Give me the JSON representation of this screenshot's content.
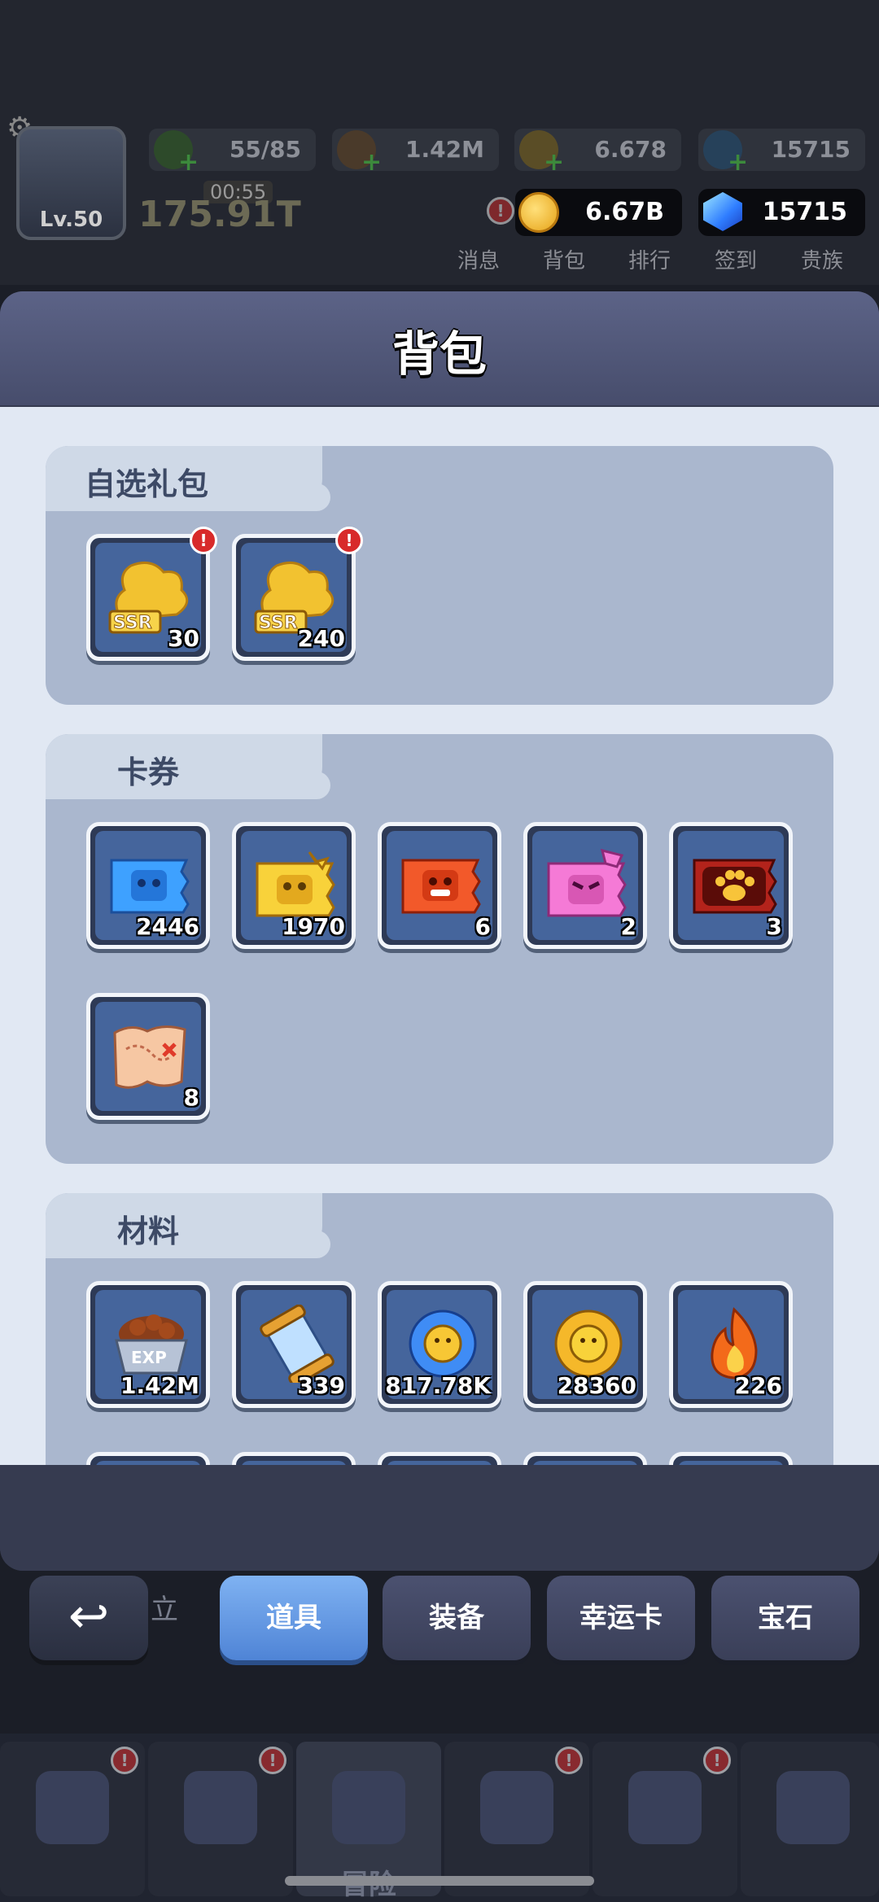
{
  "hud": {
    "level": "Lv.50",
    "energy": "55/85",
    "exp": "1.42M",
    "gold_dim": "6.678",
    "gems_dim": "15715",
    "power": "175.91T",
    "timer": "00:55",
    "gold": "6.67B",
    "gems": "15715",
    "nav": [
      "消息",
      "背包",
      "排行",
      "签到",
      "贵族"
    ]
  },
  "panel": {
    "title": "背包",
    "sections": [
      {
        "title": "自选礼包",
        "items": [
          {
            "icon": "ssr-chest-icon",
            "count": "30",
            "badge": "!"
          },
          {
            "icon": "ssr-chest-icon",
            "count": "240",
            "badge": "!"
          }
        ]
      },
      {
        "title": "卡券",
        "items": [
          {
            "icon": "blue-ticket-icon",
            "count": "2446"
          },
          {
            "icon": "gold-ticket-icon",
            "count": "1970"
          },
          {
            "icon": "red-ticket-icon",
            "count": "6"
          },
          {
            "icon": "pink-ticket-icon",
            "count": "2"
          },
          {
            "icon": "paw-ticket-icon",
            "count": "3"
          },
          {
            "icon": "treasure-map-icon",
            "count": "8"
          }
        ]
      },
      {
        "title": "材料",
        "items": [
          {
            "icon": "exp-food-bowl-icon",
            "count": "1.42M"
          },
          {
            "icon": "scroll-potion-icon",
            "count": "339"
          },
          {
            "icon": "blue-flower-icon",
            "count": "817.78K"
          },
          {
            "icon": "gold-flower-icon",
            "count": "28360"
          },
          {
            "icon": "flame-icon",
            "count": "226"
          }
        ]
      }
    ]
  },
  "tabs": [
    "道具",
    "装备",
    "幸运卡",
    "宝石"
  ],
  "active_tab": "道具",
  "behind_text": [
    "立"
  ],
  "bottom_nav": {
    "main_label": "冒险"
  },
  "colors": {
    "accent_tab": "#5e92e0",
    "badge": "#d82a2a",
    "panel_bg": "#e1e8f3",
    "section_bg": "#aab7ce"
  }
}
